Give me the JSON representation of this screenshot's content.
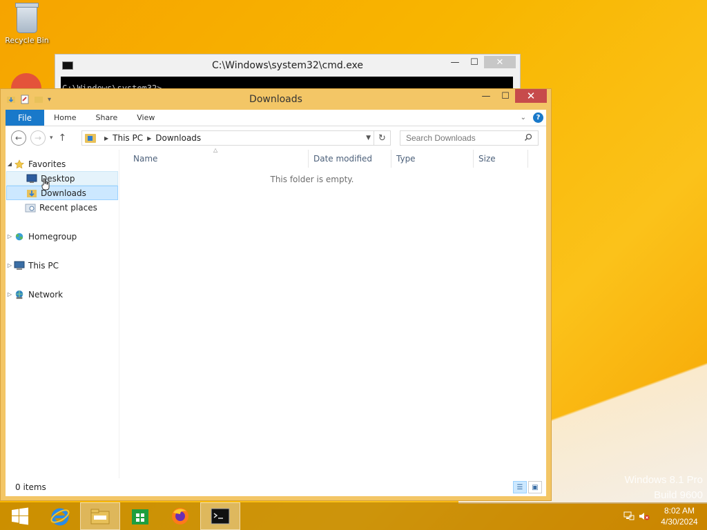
{
  "desktop": {
    "recycle_bin_label": "Recycle Bin",
    "watermark_line1": "Windows 8.1 Pro",
    "watermark_line2": "Build 9600"
  },
  "cmd": {
    "title": "C:\\Windows\\system32\\cmd.exe",
    "partial_line": "C:\\Windows\\system32>..."
  },
  "explorer": {
    "title": "Downloads",
    "ribbon": {
      "file": "File",
      "tabs": [
        "Home",
        "Share",
        "View"
      ]
    },
    "address": {
      "crumbs": [
        "This PC",
        "Downloads"
      ]
    },
    "search_placeholder": "Search Downloads",
    "tree": {
      "favorites": "Favorites",
      "desktop": "Desktop",
      "downloads": "Downloads",
      "recent": "Recent places",
      "homegroup": "Homegroup",
      "thispc": "This PC",
      "network": "Network"
    },
    "columns": [
      "Name",
      "Date modified",
      "Type",
      "Size"
    ],
    "empty_message": "This folder is empty.",
    "status_items": "0 items"
  },
  "taskbar": {
    "time": "8:02 AM",
    "date": "4/30/2024"
  },
  "colors": {
    "accent": "#1979ca",
    "close_red": "#c74b4b",
    "frame": "#f3c666"
  }
}
